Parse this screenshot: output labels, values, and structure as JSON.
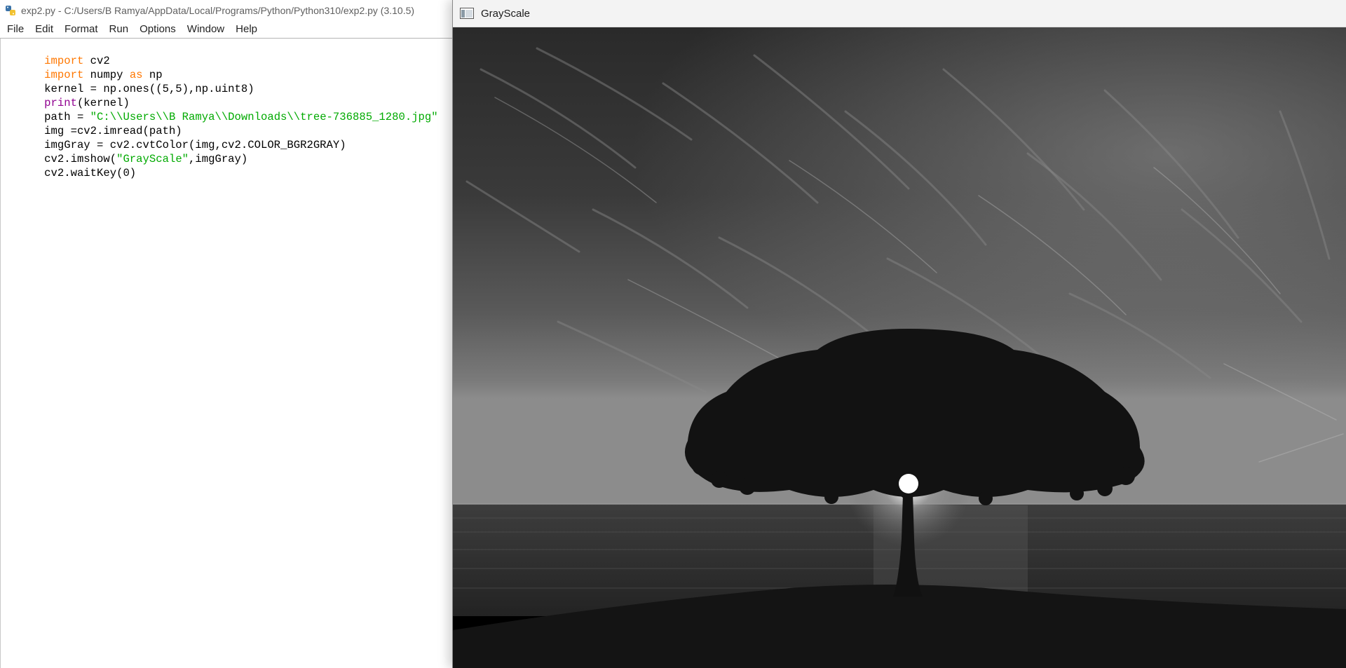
{
  "idle": {
    "title": "exp2.py - C:/Users/B Ramya/AppData/Local/Programs/Python/Python310/exp2.py (3.10.5)",
    "icon": "python-icon",
    "menu": [
      "File",
      "Edit",
      "Format",
      "Run",
      "Options",
      "Window",
      "Help"
    ],
    "code": [
      [
        {
          "t": "import",
          "c": "kw"
        },
        {
          "t": " cv2",
          "c": ""
        }
      ],
      [
        {
          "t": "import",
          "c": "kw"
        },
        {
          "t": " numpy ",
          "c": ""
        },
        {
          "t": "as",
          "c": "kw"
        },
        {
          "t": " np",
          "c": ""
        }
      ],
      [
        {
          "t": "kernel = np.ones((5,5),np.uint8)",
          "c": ""
        }
      ],
      [
        {
          "t": "print",
          "c": "bi"
        },
        {
          "t": "(kernel)",
          "c": ""
        }
      ],
      [
        {
          "t": "path = ",
          "c": ""
        },
        {
          "t": "\"C:\\\\Users\\\\B Ramya\\\\Downloads\\\\tree-736885_1280.jpg\"",
          "c": "str"
        }
      ],
      [
        {
          "t": "img =cv2.imread(path)",
          "c": ""
        }
      ],
      [
        {
          "t": "imgGray = cv2.cvtColor(img,cv2.COLOR_BGR2GRAY)",
          "c": ""
        }
      ],
      [
        {
          "t": "cv2.imshow(",
          "c": ""
        },
        {
          "t": "\"GrayScale\"",
          "c": "str"
        },
        {
          "t": ",imgGray)",
          "c": ""
        }
      ],
      [
        {
          "t": "cv2.waitKey(0)",
          "c": ""
        }
      ]
    ],
    "colors": {
      "keyword": "#ff7700",
      "builtin": "#900090",
      "string": "#00aa00"
    }
  },
  "grayscale_window": {
    "title": "GrayScale",
    "icon": "window-icon",
    "image": "grayscale-tree-sunset-photo"
  }
}
